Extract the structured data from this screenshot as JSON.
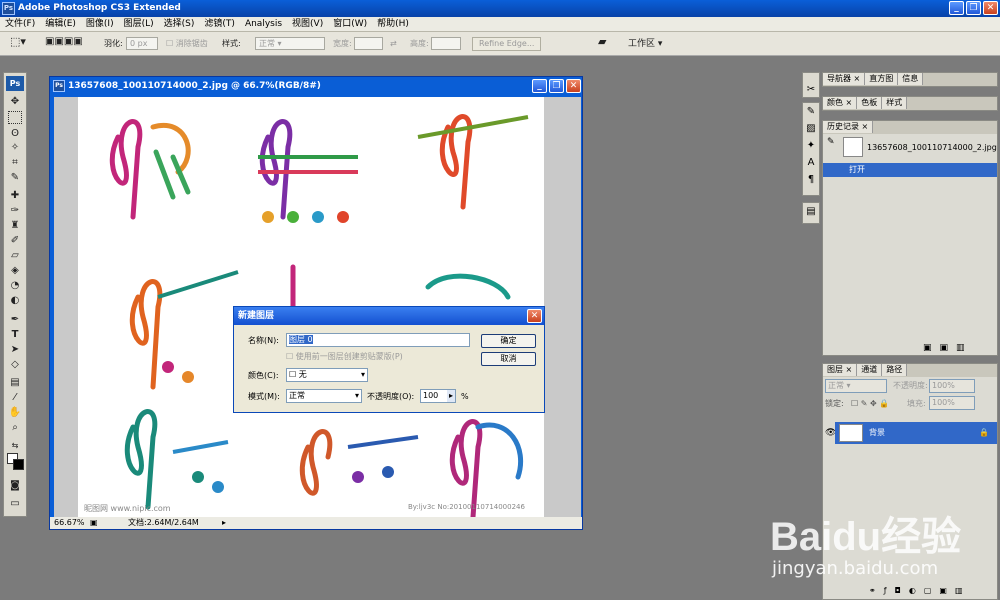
{
  "app": {
    "title": "Adobe Photoshop CS3 Extended",
    "logo": "Ps"
  },
  "window_controls": {
    "minimize": "_",
    "restore": "❐",
    "close": "✕"
  },
  "menu": [
    "文件(F)",
    "编辑(E)",
    "图像(I)",
    "图层(L)",
    "选择(S)",
    "滤镜(T)",
    "Analysis",
    "视图(V)",
    "窗口(W)",
    "帮助(H)"
  ],
  "options": {
    "feather_label": "羽化:",
    "feather_value": "0 px",
    "antialias_label": "消除锯齿",
    "style_label": "样式:",
    "style_value": "正常",
    "width_label": "宽度:",
    "height_label": "高度:",
    "refine_edge": "Refine Edge...",
    "workspace": "工作区 ▾"
  },
  "document": {
    "title": "13657608_100110714000_2.jpg @ 66.7%(RGB/8#)",
    "zoom": "66.67%",
    "doc_size": "文档:2.64M/2.64M",
    "watermark_left": "昵图网 www.nipic.com",
    "watermark_right": "By:ljv3c No:20100110714000246"
  },
  "dialog": {
    "title": "新建图层",
    "name_label": "名称(N):",
    "name_value": "图层 0",
    "clip_label": "使用前一图层创建剪贴蒙版(P)",
    "color_label": "颜色(C):",
    "color_value": "无",
    "mode_label": "模式(M):",
    "mode_value": "正常",
    "opacity_label": "不透明度(O):",
    "opacity_value": "100",
    "opacity_unit": "%",
    "ok": "确定",
    "cancel": "取消"
  },
  "panels": {
    "nav_tabs": [
      "导航器 ×",
      "直方图",
      "信息"
    ],
    "color_tabs": [
      "颜色 ×",
      "色板",
      "样式"
    ],
    "history_tabs": [
      "历史记录 ×"
    ],
    "history_snapshot": "13657608_100110714000_2.jpg",
    "history_item": "打开",
    "layers_tabs": [
      "图层 ×",
      "通道",
      "路径"
    ],
    "blend_mode": "正常",
    "opacity_label": "不透明度:",
    "opacity_value": "100%",
    "lock_label": "锁定:",
    "fill_label": "填充:",
    "fill_value": "100%",
    "layer_name": "背景"
  },
  "watermark": {
    "brand": "Baidu经验",
    "url": "jingyan.baidu.com"
  }
}
